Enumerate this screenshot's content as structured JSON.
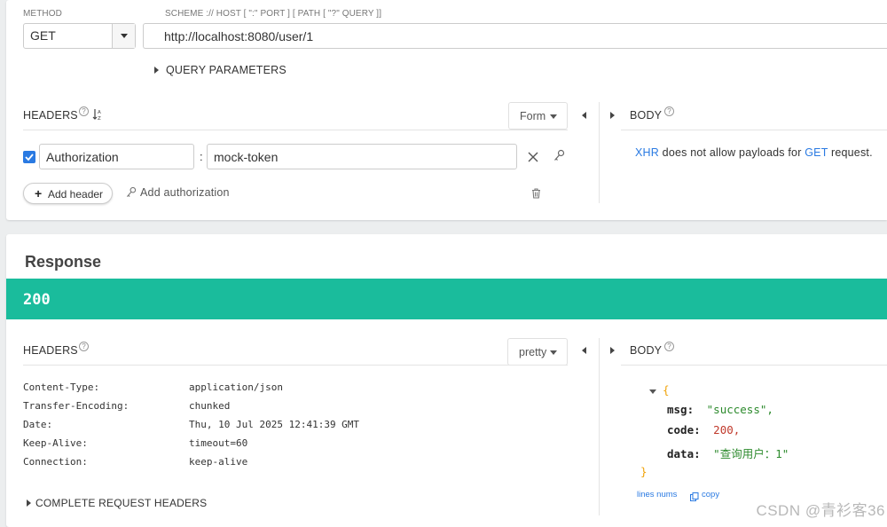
{
  "request": {
    "method_label": "METHOD",
    "method_value": "GET",
    "url_label": "SCHEME :// HOST [ \":\" PORT ] [ PATH [ \"?\" QUERY ]]",
    "url_value": "http://localhost:8080/user/1",
    "query_params_label": "QUERY PARAMETERS",
    "headers_label": "HEADERS",
    "headers_mode": "Form",
    "body_label": "BODY",
    "header_rows": [
      {
        "key": "Authorization",
        "value": "mock-token",
        "enabled": true
      }
    ],
    "colon": ":",
    "add_header_label": "Add header",
    "add_authorization_label": "Add authorization",
    "body_message": {
      "xhr": "XHR",
      "mid": " does not allow payloads for ",
      "method": "GET",
      "end": " request."
    }
  },
  "response": {
    "title": "Response",
    "status_code": "200",
    "headers_label": "HEADERS",
    "headers_mode": "pretty",
    "body_label": "BODY",
    "headers": [
      {
        "key": "Content-Type:",
        "value": "application/json"
      },
      {
        "key": "Transfer-Encoding:",
        "value": "chunked"
      },
      {
        "key": "Date:",
        "value": "Thu, 10 Jul 2025 12:41:39 GMT"
      },
      {
        "key": "Keep-Alive:",
        "value": "timeout=60"
      },
      {
        "key": "Connection:",
        "value": "keep-alive"
      }
    ],
    "complete_request_headers_label": "COMPLETE REQUEST HEADERS",
    "body_json": {
      "open": "{",
      "close": "}",
      "fields": [
        {
          "key": "msg:",
          "value": "\"success\",",
          "kind": "string"
        },
        {
          "key": "code:",
          "value": "200,",
          "kind": "number"
        },
        {
          "key": "data:",
          "value": "\"查询用户：1\"",
          "kind": "string"
        }
      ]
    },
    "lines_nums_label": "lines nums",
    "copy_label": "copy"
  },
  "help_glyph": "?",
  "watermark": "CSDN @青衫客36",
  "colors": {
    "status_bar": "#1abc9c",
    "link": "#2a7ae2",
    "checkbox": "#2a7ae2",
    "json_brace": "#f0a30a",
    "json_string": "#2c8a2c",
    "json_number": "#c0392b"
  },
  "icons": [
    "chevron-down-icon",
    "caret-right-icon",
    "caret-left-icon",
    "help-icon",
    "sort-icon",
    "check-icon",
    "close-icon",
    "key-icon",
    "trash-icon",
    "plus-icon",
    "copy-icon"
  ]
}
